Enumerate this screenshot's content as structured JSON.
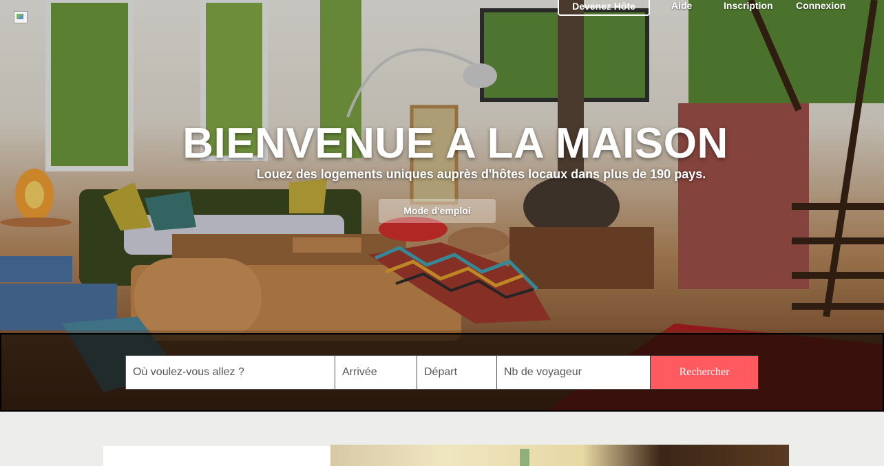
{
  "nav": {
    "host_label": "Devenez Hôte",
    "help_label": "Aide",
    "signup_label": "Inscription",
    "login_label": "Connexion"
  },
  "hero": {
    "title": "BIENVENUE A LA MAISON",
    "subtitle": "Louez des logements uniques auprès d'hôtes locaux dans plus de 190 pays.",
    "howto_label": "Mode d'emploi"
  },
  "search": {
    "where_placeholder": "Où voulez-vous allez ?",
    "checkin_placeholder": "Arrivée",
    "checkout_placeholder": "Départ",
    "guests_placeholder": "Nb de voyageur",
    "button_label": "Rechercher"
  },
  "colors": {
    "accent": "#ff5a5f"
  }
}
